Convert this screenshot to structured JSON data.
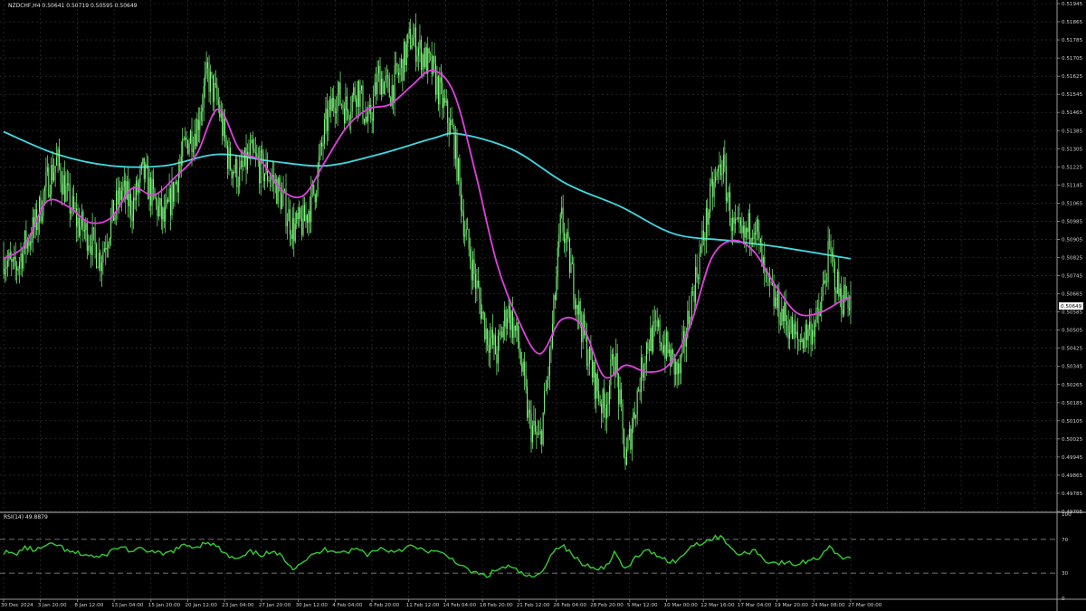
{
  "window": {
    "header": "NZDCHF,H4  0.50641 0.50719 0.50595 0.50649",
    "rsi_header": "RSI(14) 49.8879",
    "current_price": "0.50649"
  },
  "colors": {
    "background": "#000000",
    "grid": "#3a3a3a",
    "candle": "#7CFC7C",
    "ma_fast": "#E040E0",
    "ma_slow": "#40D8E0",
    "rsi_line": "#32CD32",
    "axis_text": "#d0d0d0",
    "price_tag_bg": "#ffffff"
  },
  "chart_data": [
    {
      "type": "candlestick",
      "symbol": "NZDCHF",
      "timeframe": "H4",
      "ylim": [
        0.49705,
        0.51945
      ],
      "y_ticks": [
        "0.51945",
        "0.51865",
        "0.51785",
        "0.51705",
        "0.51625",
        "0.51545",
        "0.51465",
        "0.51385",
        "0.51305",
        "0.51225",
        "0.51145",
        "0.51065",
        "0.50985",
        "0.50905",
        "0.50825",
        "0.50745",
        "0.50665",
        "0.50585",
        "0.50505",
        "0.50425",
        "0.50345",
        "0.50265",
        "0.50185",
        "0.50105",
        "0.50025",
        "0.49945",
        "0.49865",
        "0.49785",
        "0.49705"
      ],
      "x_ticks": [
        "30 Dec 2024",
        "3 Jan 20:00",
        "8 Jan 12:00",
        "13 Jan 04:00",
        "15 Jan 20:00",
        "20 Jan 12:00",
        "23 Jan 04:00",
        "27 Jan 20:00",
        "30 Jan 12:00",
        "4 Feb 04:00",
        "6 Feb 20:00",
        "11 Feb 12:00",
        "14 Feb 04:00",
        "18 Feb 20:00",
        "21 Feb 12:00",
        "26 Feb 04:00",
        "28 Feb 20:00",
        "5 Mar 12:00",
        "10 Mar 00:00",
        "12 Mar 16:00",
        "17 Mar 04:00",
        "19 Mar 20:00",
        "24 Mar 08:00",
        "27 Mar 00:00"
      ],
      "close_path": [
        [
          0,
          0.5083
        ],
        [
          2,
          0.5076
        ],
        [
          4,
          0.5088
        ],
        [
          6,
          0.5097
        ],
        [
          8,
          0.5115
        ],
        [
          10,
          0.5125
        ],
        [
          12,
          0.5108
        ],
        [
          14,
          0.5097
        ],
        [
          16,
          0.5092
        ],
        [
          18,
          0.5082
        ],
        [
          20,
          0.5098
        ],
        [
          22,
          0.5112
        ],
        [
          24,
          0.5105
        ],
        [
          26,
          0.512
        ],
        [
          28,
          0.5108
        ],
        [
          30,
          0.5098
        ],
        [
          32,
          0.5115
        ],
        [
          34,
          0.5133
        ],
        [
          36,
          0.514
        ],
        [
          38,
          0.5163
        ],
        [
          40,
          0.515
        ],
        [
          42,
          0.5125
        ],
        [
          44,
          0.5118
        ],
        [
          46,
          0.5128
        ],
        [
          48,
          0.5122
        ],
        [
          50,
          0.5118
        ],
        [
          52,
          0.5108
        ],
        [
          54,
          0.5095
        ],
        [
          56,
          0.5098
        ],
        [
          58,
          0.5112
        ],
        [
          60,
          0.514
        ],
        [
          62,
          0.5155
        ],
        [
          64,
          0.5148
        ],
        [
          66,
          0.5158
        ],
        [
          68,
          0.514
        ],
        [
          70,
          0.5163
        ],
        [
          72,
          0.5155
        ],
        [
          74,
          0.5165
        ],
        [
          76,
          0.518
        ],
        [
          78,
          0.5172
        ],
        [
          80,
          0.5165
        ],
        [
          82,
          0.515
        ],
        [
          84,
          0.5135
        ],
        [
          86,
          0.5095
        ],
        [
          88,
          0.5072
        ],
        [
          90,
          0.505
        ],
        [
          92,
          0.504
        ],
        [
          94,
          0.506
        ],
        [
          96,
          0.5045
        ],
        [
          98,
          0.501
        ],
        [
          100,
          0.5
        ],
        [
          102,
          0.504
        ],
        [
          104,
          0.51
        ],
        [
          106,
          0.5075
        ],
        [
          108,
          0.505
        ],
        [
          110,
          0.503
        ],
        [
          112,
          0.5015
        ],
        [
          114,
          0.504
        ],
        [
          116,
          0.4992
        ],
        [
          118,
          0.502
        ],
        [
          120,
          0.5045
        ],
        [
          122,
          0.505
        ],
        [
          124,
          0.504
        ],
        [
          126,
          0.503
        ],
        [
          128,
          0.506
        ],
        [
          130,
          0.5085
        ],
        [
          132,
          0.511
        ],
        [
          134,
          0.5125
        ],
        [
          136,
          0.5095
        ],
        [
          138,
          0.509
        ],
        [
          140,
          0.51
        ],
        [
          142,
          0.5072
        ],
        [
          144,
          0.5062
        ],
        [
          146,
          0.5055
        ],
        [
          148,
          0.5045
        ],
        [
          150,
          0.505
        ],
        [
          152,
          0.5055
        ],
        [
          154,
          0.5085
        ],
        [
          156,
          0.5065
        ],
        [
          158,
          0.5065
        ]
      ],
      "series": [
        {
          "type": "line",
          "values": [
            [
              0,
              0.5082
            ],
            [
              4,
              0.5088
            ],
            [
              8,
              0.5107
            ],
            [
              12,
              0.5105
            ],
            [
              16,
              0.5098
            ],
            [
              20,
              0.51
            ],
            [
              24,
              0.5113
            ],
            [
              28,
              0.511
            ],
            [
              32,
              0.5118
            ],
            [
              36,
              0.5128
            ],
            [
              40,
              0.5148
            ],
            [
              44,
              0.513
            ],
            [
              48,
              0.5125
            ],
            [
              52,
              0.5112
            ],
            [
              56,
              0.511
            ],
            [
              60,
              0.5125
            ],
            [
              64,
              0.514
            ],
            [
              68,
              0.5148
            ],
            [
              72,
              0.515
            ],
            [
              76,
              0.5158
            ],
            [
              80,
              0.5165
            ],
            [
              84,
              0.5155
            ],
            [
              88,
              0.512
            ],
            [
              92,
              0.508
            ],
            [
              96,
              0.5055
            ],
            [
              100,
              0.504
            ],
            [
              104,
              0.5055
            ],
            [
              108,
              0.5052
            ],
            [
              112,
              0.503
            ],
            [
              116,
              0.5035
            ],
            [
              120,
              0.5032
            ],
            [
              124,
              0.5035
            ],
            [
              128,
              0.5052
            ],
            [
              132,
              0.5082
            ],
            [
              136,
              0.509
            ],
            [
              140,
              0.5085
            ],
            [
              144,
              0.507
            ],
            [
              148,
              0.5058
            ],
            [
              152,
              0.5058
            ],
            [
              156,
              0.5063
            ],
            [
              158,
              0.5065
            ]
          ]
        },
        {
          "type": "line",
          "values": [
            [
              0,
              0.5138
            ],
            [
              10,
              0.5128
            ],
            [
              20,
              0.5123
            ],
            [
              30,
              0.5123
            ],
            [
              40,
              0.5128
            ],
            [
              50,
              0.5125
            ],
            [
              60,
              0.5123
            ],
            [
              70,
              0.5128
            ],
            [
              80,
              0.5135
            ],
            [
              85,
              0.5137
            ],
            [
              95,
              0.513
            ],
            [
              105,
              0.5115
            ],
            [
              115,
              0.5105
            ],
            [
              125,
              0.5093
            ],
            [
              135,
              0.509
            ],
            [
              145,
              0.5087
            ],
            [
              158,
              0.5082
            ]
          ]
        }
      ]
    },
    {
      "type": "line",
      "ylim": [
        0,
        100
      ],
      "y_ticks": [
        "100",
        "70",
        "30",
        "0"
      ],
      "levels": [
        70,
        30
      ],
      "values": [
        [
          0,
          55
        ],
        [
          2,
          52
        ],
        [
          4,
          60
        ],
        [
          6,
          57
        ],
        [
          8,
          62
        ],
        [
          10,
          64
        ],
        [
          12,
          55
        ],
        [
          14,
          53
        ],
        [
          16,
          51
        ],
        [
          18,
          48
        ],
        [
          20,
          56
        ],
        [
          22,
          62
        ],
        [
          24,
          55
        ],
        [
          26,
          59
        ],
        [
          28,
          54
        ],
        [
          30,
          52
        ],
        [
          32,
          58
        ],
        [
          34,
          63
        ],
        [
          36,
          61
        ],
        [
          38,
          68
        ],
        [
          40,
          60
        ],
        [
          42,
          49
        ],
        [
          44,
          46
        ],
        [
          46,
          55
        ],
        [
          48,
          52
        ],
        [
          50,
          54
        ],
        [
          52,
          50
        ],
        [
          54,
          36
        ],
        [
          56,
          45
        ],
        [
          58,
          52
        ],
        [
          60,
          58
        ],
        [
          62,
          57
        ],
        [
          64,
          55
        ],
        [
          66,
          59
        ],
        [
          68,
          52
        ],
        [
          70,
          60
        ],
        [
          72,
          56
        ],
        [
          74,
          58
        ],
        [
          76,
          62
        ],
        [
          78,
          57
        ],
        [
          80,
          56
        ],
        [
          82,
          52
        ],
        [
          84,
          46
        ],
        [
          86,
          35
        ],
        [
          88,
          30
        ],
        [
          90,
          26
        ],
        [
          92,
          34
        ],
        [
          94,
          38
        ],
        [
          96,
          32
        ],
        [
          98,
          25
        ],
        [
          100,
          27
        ],
        [
          102,
          52
        ],
        [
          104,
          64
        ],
        [
          106,
          52
        ],
        [
          108,
          40
        ],
        [
          110,
          38
        ],
        [
          112,
          35
        ],
        [
          114,
          55
        ],
        [
          116,
          32
        ],
        [
          118,
          50
        ],
        [
          120,
          56
        ],
        [
          122,
          52
        ],
        [
          124,
          44
        ],
        [
          126,
          45
        ],
        [
          128,
          62
        ],
        [
          130,
          66
        ],
        [
          132,
          70
        ],
        [
          134,
          75
        ],
        [
          136,
          55
        ],
        [
          138,
          52
        ],
        [
          140,
          58
        ],
        [
          142,
          45
        ],
        [
          144,
          42
        ],
        [
          146,
          42
        ],
        [
          148,
          40
        ],
        [
          150,
          45
        ],
        [
          152,
          48
        ],
        [
          154,
          63
        ],
        [
          156,
          48
        ],
        [
          158,
          50
        ]
      ]
    }
  ]
}
